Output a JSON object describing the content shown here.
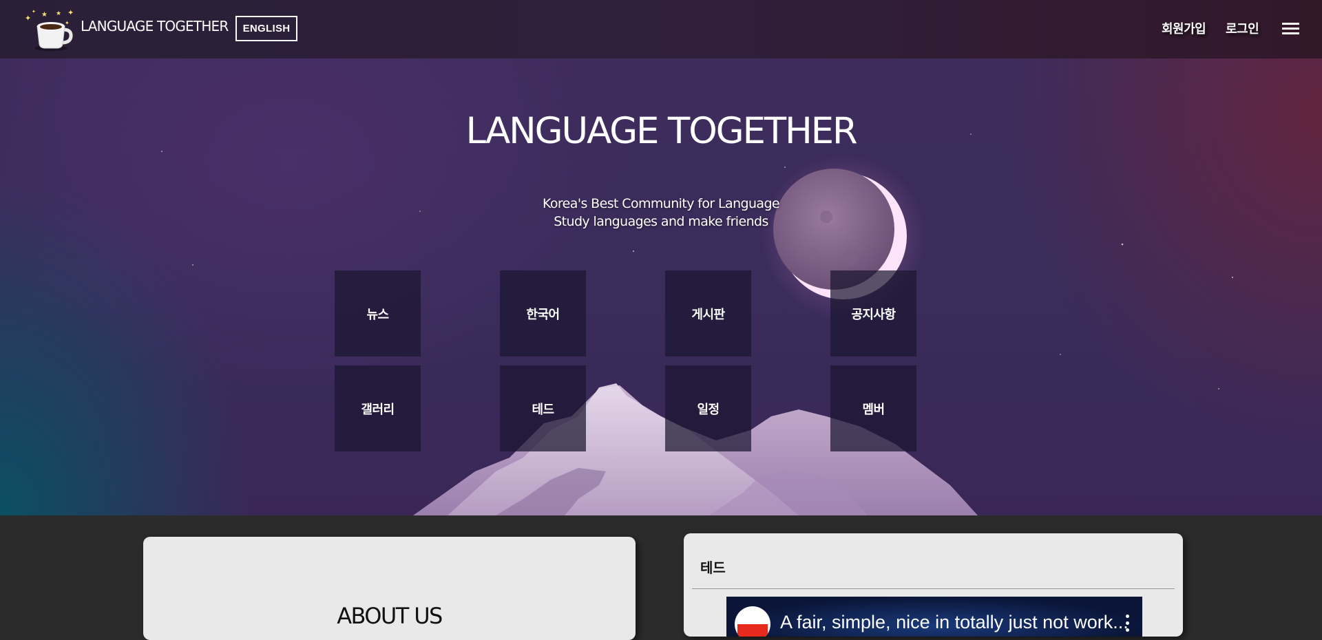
{
  "header": {
    "brand": "LANGUAGE TOGETHER",
    "language_button": "ENGLISH",
    "signup": "회원가입",
    "login": "로그인",
    "menu_icon": "hamburger-menu-icon",
    "logo_icon": "coffee-cup-stars-logo"
  },
  "hero": {
    "title": "LANGUAGE TOGETHER",
    "subtitle_line1": "Korea's Best Community for Language",
    "subtitle_line2": "Study languages and make friends",
    "tiles": [
      "뉴스",
      "한국어",
      "게시판",
      "공지사항",
      "갤러리",
      "테드",
      "일정",
      "멤버"
    ]
  },
  "about": {
    "title": "ABOUT US"
  },
  "ted": {
    "title": "테드",
    "video_title": "A fair, simple, nice in totally just not work..."
  },
  "colors": {
    "topbar": "#2d1f38",
    "content_bg": "#2b2b2b",
    "card_bg": "#e9e9e9",
    "tile_bg": "#1c1630"
  }
}
